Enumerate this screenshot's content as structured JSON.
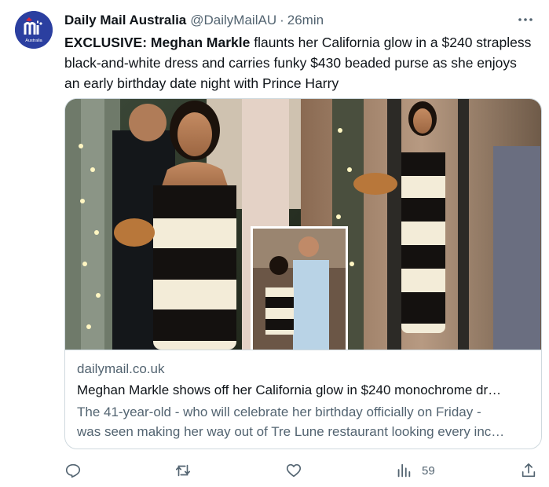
{
  "tweet": {
    "author_name": "Daily Mail Australia",
    "handle": "@DailyMailAU",
    "separator": "·",
    "time": "26min",
    "avatar": {
      "icon": "daily-mail-logo",
      "logo_text": "Australia",
      "bg": "#2b3fa0"
    },
    "text": {
      "prefix": "EXCLUSIVE:",
      "name": "Meghan Markle",
      "body": " flaunts her California glow in a $240 strapless black-and-white dress and carries funky $430 beaded purse as she enjoys an early birthday date night with Prince Harry"
    }
  },
  "card": {
    "domain": "dailymail.co.uk",
    "title": "Meghan Markle shows off her California glow in $240 monochrome dr…",
    "description_line1": "The 41-year-old - who will celebrate her birthday officially on Friday -",
    "description_line2": "was seen making her way out of Tre Lune restaurant looking every inc…"
  },
  "actions": {
    "reply": {
      "icon": "reply-icon"
    },
    "retweet": {
      "icon": "retweet-icon"
    },
    "like": {
      "icon": "heart-icon"
    },
    "views": {
      "icon": "analytics-icon",
      "count": "59"
    },
    "share": {
      "icon": "share-icon"
    }
  },
  "colors": {
    "text": "#0f1419",
    "secondary": "#536471",
    "border": "#cfd9de"
  }
}
